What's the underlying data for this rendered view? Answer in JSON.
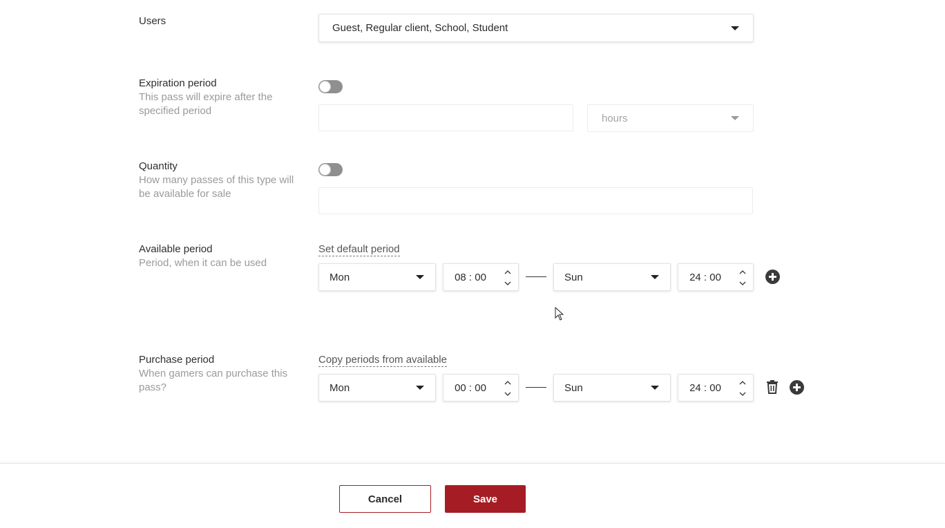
{
  "users": {
    "title": "Users",
    "selected": "Guest, Regular client, School, Student"
  },
  "expiration": {
    "title": "Expiration period",
    "description": "This pass will expire after the specified period",
    "enabled": false,
    "value": "",
    "unit": "hours"
  },
  "quantity": {
    "title": "Quantity",
    "description": "How many passes of this type will be available for sale",
    "enabled": false,
    "value": ""
  },
  "available_period": {
    "title": "Available period",
    "description": "Period, when it can be used",
    "link": "Set default period",
    "start_day": "Mon",
    "start_time": "08 : 00",
    "end_day": "Sun",
    "end_time": "24 : 00"
  },
  "purchase_period": {
    "title": "Purchase period",
    "description": "When gamers can purchase this pass?",
    "link": "Copy periods from available",
    "start_day": "Mon",
    "start_time": "00 : 00",
    "end_day": "Sun",
    "end_time": "24 : 00"
  },
  "footer": {
    "cancel_label": "Cancel",
    "save_label": "Save"
  },
  "colors": {
    "accent": "#a61c24",
    "toggle_off": "#8f8f8f"
  }
}
